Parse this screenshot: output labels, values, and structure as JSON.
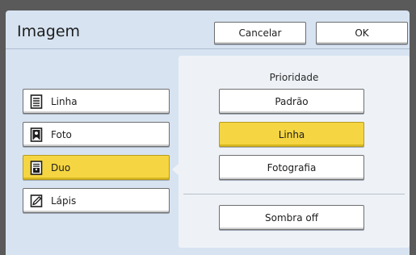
{
  "window": {
    "title": "Imagem"
  },
  "header": {
    "cancel_label": "Cancelar",
    "ok_label": "OK"
  },
  "modes": [
    {
      "label": "Linha",
      "icon": "text-page-icon",
      "selected": false
    },
    {
      "label": "Foto",
      "icon": "photo-portrait-icon",
      "selected": false
    },
    {
      "label": "Duo",
      "icon": "text-photo-page-icon",
      "selected": true
    },
    {
      "label": "Lápis",
      "icon": "pencil-sketch-icon",
      "selected": false
    }
  ],
  "priority": {
    "title": "Prioridade",
    "options": [
      {
        "label": "Padrão",
        "selected": false
      },
      {
        "label": "Linha",
        "selected": true
      },
      {
        "label": "Fotografia",
        "selected": false
      }
    ]
  },
  "shadow": {
    "label": "Sombra off"
  },
  "colors": {
    "accent": "#f5d642",
    "background": "#d7e3f1",
    "panel": "#eef2f7"
  }
}
